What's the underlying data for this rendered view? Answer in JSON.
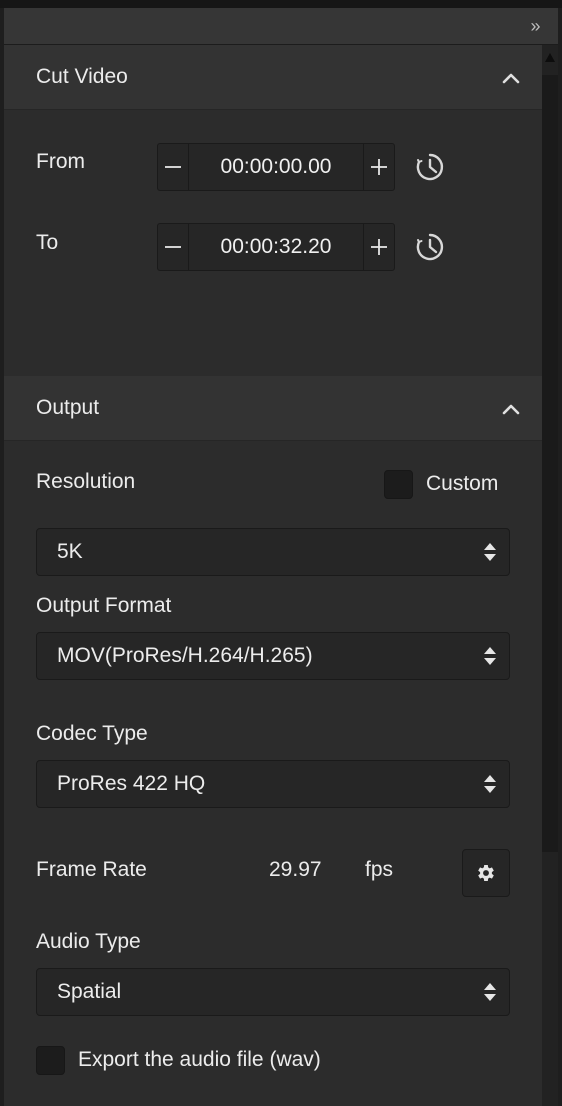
{
  "toolbar": {
    "collapse_label": "»"
  },
  "cut_video": {
    "title": "Cut Video",
    "from_label": "From",
    "from_value": "00:00:00.00",
    "to_label": "To",
    "to_value": "00:00:32.20"
  },
  "output": {
    "title": "Output",
    "resolution_label": "Resolution",
    "custom_label": "Custom",
    "custom_checked": false,
    "resolution_value": "5K",
    "output_format_label": "Output Format",
    "output_format_value": "MOV(ProRes/H.264/H.265)",
    "codec_type_label": "Codec Type",
    "codec_type_value": "ProRes 422 HQ",
    "frame_rate_label": "Frame Rate",
    "frame_rate_value": "29.97",
    "frame_rate_unit": "fps",
    "audio_type_label": "Audio Type",
    "audio_type_value": "Spatial",
    "export_audio_label": "Export the audio file (wav)",
    "export_audio_checked": false
  },
  "colors": {
    "panel_bg": "#2c2c2c",
    "header_bg": "#333333",
    "input_bg": "#262626",
    "text": "#ececec"
  }
}
